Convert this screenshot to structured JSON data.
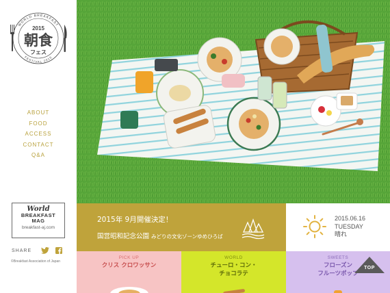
{
  "logo": {
    "year": "2015",
    "title": "朝食",
    "subtitle": "フェス",
    "ring_top": "WORLD BREAKFAST",
    "ring_bottom": "FESTIVAL 2015"
  },
  "nav": {
    "items": [
      {
        "label": "ABOUT"
      },
      {
        "label": "FOOD"
      },
      {
        "label": "ACCESS"
      },
      {
        "label": "CONTACT"
      },
      {
        "label": "Q&A"
      }
    ]
  },
  "magazine": {
    "world": "World",
    "line1": "BREAKFAST",
    "line2": "MAG",
    "url": "breakfast-aj.com"
  },
  "share": {
    "label": "SHARE"
  },
  "copyright": "©Breakfast Association of Japan",
  "announcement": {
    "headline": "2015年 9月開催決定！",
    "venue": "国営昭和記念公園",
    "venue_sub": "みどりの文化ゾーンゆめひろば"
  },
  "weather": {
    "date": "2015.06.16",
    "day": "TUESDAY",
    "condition": "晴れ",
    "icon": "sun-icon"
  },
  "cards": [
    {
      "category": "PICK UP",
      "title_line1": "クリス クロワッサン",
      "title_line2": ""
    },
    {
      "category": "WORLD",
      "title_line1": "チューロ・コン・",
      "title_line2": "チョコラテ"
    },
    {
      "category": "SWEETS",
      "title_line1": "フローズン",
      "title_line2": "フルーツポップ"
    }
  ],
  "top_button": {
    "label": "TOP"
  },
  "colors": {
    "gold": "#bfa33b",
    "pink": "#f7c4c4",
    "lime": "#d4e62a",
    "lavender": "#d6c0ee",
    "grass": "#58a53a"
  }
}
